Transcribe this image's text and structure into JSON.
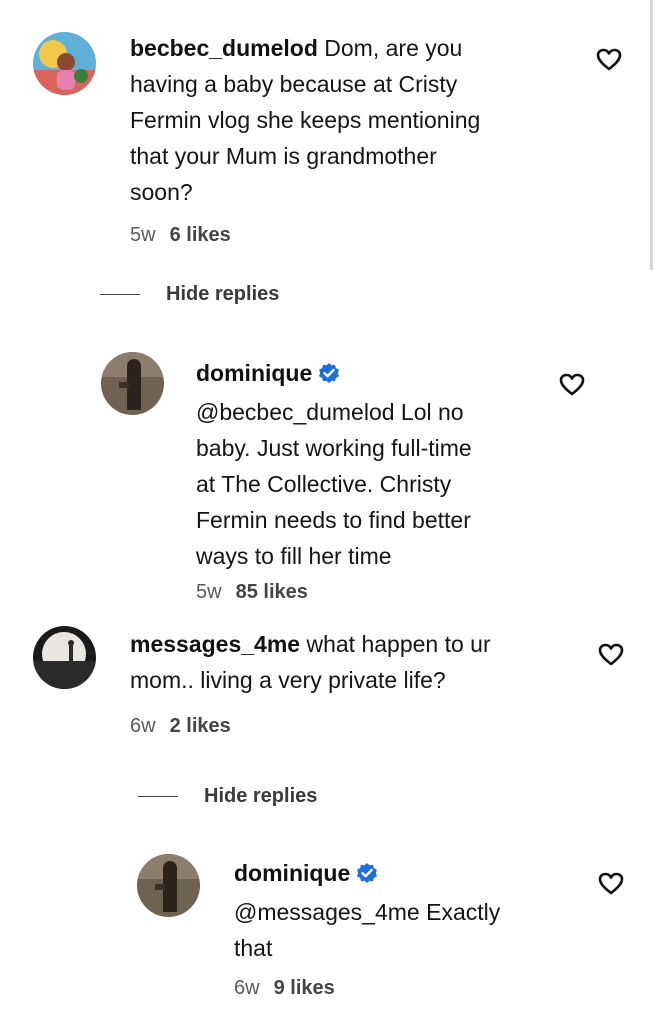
{
  "comments": [
    {
      "username": "becbec_dumelod",
      "text": "Dom, are you having a baby because at Cristy Fermin vlog she keeps mentioning that your Mum is grandmother soon?",
      "lines": [
        "becbec_dumelod Dom, are you",
        "having a baby because at Cristy",
        "Fermin vlog she keeps mentioning",
        "that your Mum is grandmother",
        "soon?"
      ],
      "age": "5w",
      "likes": "6 likes",
      "avatar_icon": "colorful-photo-avatar"
    },
    {
      "username": "dominique",
      "verified": true,
      "text": "@becbec_dumelod Lol no baby. Just working full-time at The Collective. Christy Fermin needs to find better ways to fill her time",
      "lines": [
        "@becbec_dumelod Lol no",
        "baby. Just working full-time",
        "at The Collective. Christy",
        "Fermin needs to find better",
        "ways to fill her time"
      ],
      "age": "5w",
      "likes": "85 likes",
      "avatar_icon": "dark-photo-avatar"
    },
    {
      "username": "messages_4me",
      "text": "what happen to ur mom.. living a very private life?",
      "lines": [
        "messages_4me what happen to ur",
        "mom.. living a very private life?"
      ],
      "age": "6w",
      "likes": "2 likes",
      "avatar_icon": "sunset-silhouette-avatar"
    },
    {
      "username": "dominique",
      "verified": true,
      "text": "@messages_4me Exactly that",
      "lines": [
        "@messages_4me Exactly",
        "that"
      ],
      "age": "6w",
      "likes": "9 likes",
      "avatar_icon": "dark-photo-avatar"
    }
  ],
  "hide_replies_label": "Hide replies",
  "icons": {
    "like": "heart-outline-icon",
    "verified": "verified-badge-icon"
  },
  "colors": {
    "verified_blue": "#1d6fe0",
    "text": "#151515",
    "meta": "#5a5a5a"
  }
}
